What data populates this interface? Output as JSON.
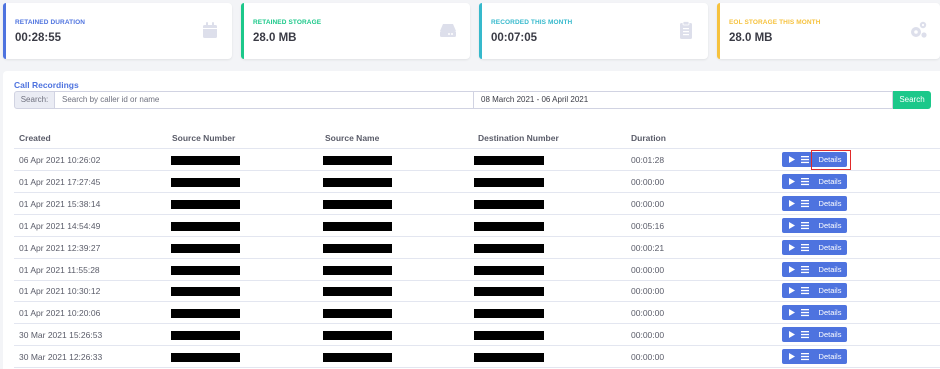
{
  "cards": [
    {
      "label": "RETAINED DURATION",
      "value": "00:28:55",
      "color": "#4e73df",
      "icon": "calendar-icon"
    },
    {
      "label": "RETAINED STORAGE",
      "value": "28.0 MB",
      "color": "#1cc88a",
      "icon": "hard-drive-icon"
    },
    {
      "label": "RECORDED THIS MONTH",
      "value": "00:07:05",
      "color": "#36b9cc",
      "icon": "clipboard-icon"
    },
    {
      "label": "EOL STORAGE THIS MONTH",
      "value": "28.0 MB",
      "color": "#f6c23e",
      "icon": "cogs-icon"
    }
  ],
  "panel": {
    "title": "Call Recordings",
    "search_label": "Search:",
    "search_placeholder": "Search by caller id or name",
    "date_range": "08 March 2021 - 06 April 2021",
    "search_button": "Search"
  },
  "table": {
    "headers": [
      "Created",
      "Source Number",
      "Source Name",
      "Destination Number",
      "Duration"
    ],
    "action_label": "Details",
    "rows": [
      {
        "created": "06 Apr 2021 10:26:02",
        "duration": "00:01:28"
      },
      {
        "created": "01 Apr 2021 17:27:45",
        "duration": "00:00:00"
      },
      {
        "created": "01 Apr 2021 15:38:14",
        "duration": "00:00:00"
      },
      {
        "created": "01 Apr 2021 14:54:49",
        "duration": "00:05:16"
      },
      {
        "created": "01 Apr 2021 12:39:27",
        "duration": "00:00:21"
      },
      {
        "created": "01 Apr 2021 11:55:28",
        "duration": "00:00:00"
      },
      {
        "created": "01 Apr 2021 10:30:12",
        "duration": "00:00:00"
      },
      {
        "created": "01 Apr 2021 10:20:06",
        "duration": "00:00:00"
      },
      {
        "created": "30 Mar 2021 15:26:53",
        "duration": "00:00:00"
      },
      {
        "created": "30 Mar 2021 12:26:33",
        "duration": "00:00:00"
      }
    ]
  }
}
